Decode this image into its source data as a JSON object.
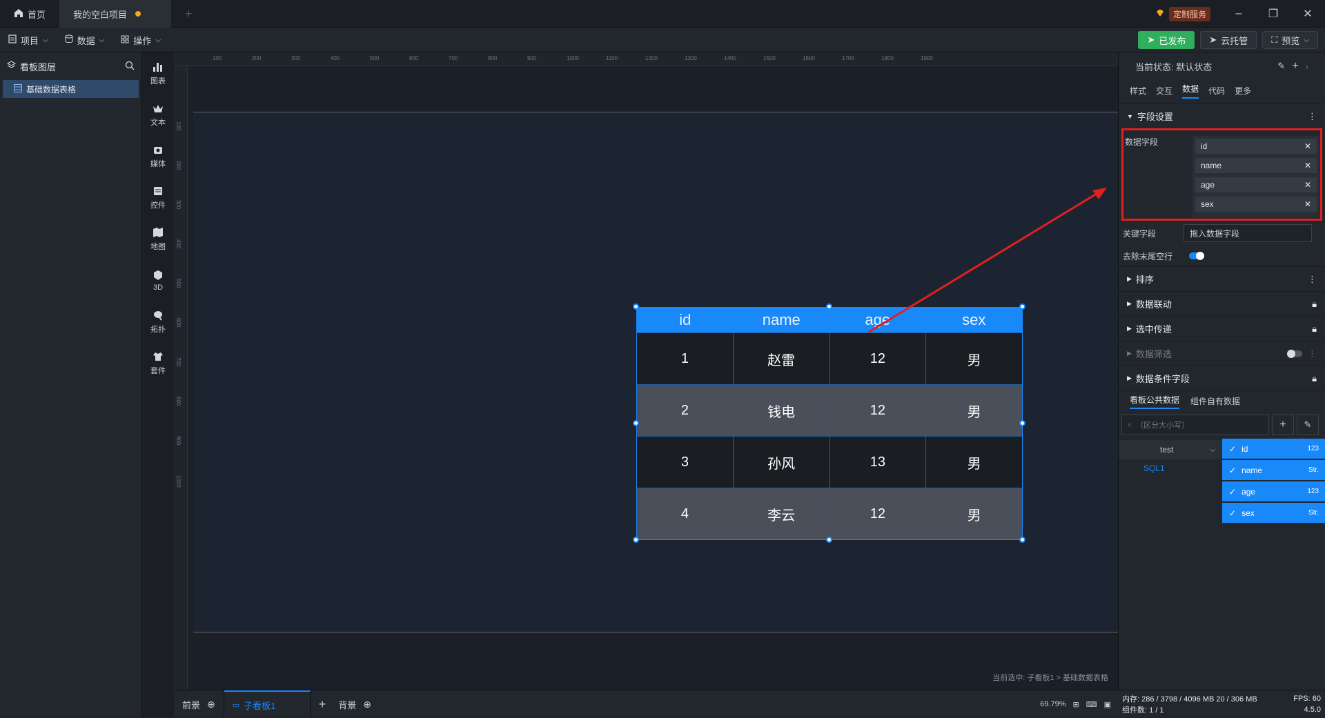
{
  "titlebar": {
    "home_tab": "首页",
    "project_tab": "我的空白项目",
    "service_badge": "定制服务"
  },
  "toolbar": {
    "menu_project": "项目",
    "menu_data": "数据",
    "menu_ops": "操作",
    "publish": "已发布",
    "cloud": "云托管",
    "preview": "预览"
  },
  "layers": {
    "title": "看板图层",
    "items": [
      "基础数据表格"
    ]
  },
  "iconbar": {
    "items": [
      {
        "label": "图表",
        "icon": "bar-chart-icon"
      },
      {
        "label": "文本",
        "icon": "text-icon"
      },
      {
        "label": "媒体",
        "icon": "media-icon"
      },
      {
        "label": "控件",
        "icon": "widget-icon"
      },
      {
        "label": "地图",
        "icon": "map-icon"
      },
      {
        "label": "3D",
        "icon": "cube-icon"
      },
      {
        "label": "拓扑",
        "icon": "topology-icon"
      },
      {
        "label": "套件",
        "icon": "kit-icon"
      }
    ]
  },
  "ruler": {
    "top": [
      "100",
      "200",
      "300",
      "400",
      "500",
      "600",
      "700",
      "800",
      "900",
      "1000",
      "1100",
      "1200",
      "1300",
      "1400",
      "1500",
      "1600",
      "1700",
      "1800",
      "1900"
    ],
    "left": [
      "100",
      "200",
      "300",
      "400",
      "500",
      "600",
      "700",
      "800",
      "900",
      "1000"
    ]
  },
  "table": {
    "headers": [
      "id",
      "name",
      "age",
      "sex"
    ],
    "rows": [
      [
        "1",
        "赵雷",
        "12",
        "男"
      ],
      [
        "2",
        "钱电",
        "12",
        "男"
      ],
      [
        "3",
        "孙风",
        "13",
        "男"
      ],
      [
        "4",
        "李云",
        "12",
        "男"
      ]
    ]
  },
  "canvas": {
    "selection_info": "当前选中: 子看板1 > 基础数据表格"
  },
  "bottombar": {
    "front": "前景",
    "sub_board": "子看板1",
    "background": "背景",
    "zoom": "69.79%"
  },
  "rightpanel": {
    "state_label": "当前状态: 默认状态",
    "tabs": [
      "样式",
      "交互",
      "数据",
      "代码",
      "更多"
    ],
    "active_tab": "数据",
    "field_settings": "字段设置",
    "data_fields_label": "数据字段",
    "data_fields": [
      "id",
      "name",
      "age",
      "sex"
    ],
    "key_field_label": "关键字段",
    "key_field_placeholder": "拖入数据字段",
    "trim_label": "去除末尾空行",
    "sections": [
      "排序",
      "数据联动",
      "选中传递",
      "数据筛选",
      "数据条件字段"
    ],
    "source_tabs": [
      "看板公共数据",
      "组件自有数据"
    ],
    "search_placeholder": "（区分大小写）",
    "dataset": "test",
    "source": "SQL1",
    "columns": [
      {
        "name": "id",
        "type": "123"
      },
      {
        "name": "name",
        "type": "Str."
      },
      {
        "name": "age",
        "type": "123"
      },
      {
        "name": "sex",
        "type": "Str."
      }
    ]
  },
  "status": {
    "memory": "内存: 286 / 3798 / 4096 MB  20 / 306 MB",
    "fps": "FPS: 60",
    "components": "组件数: 1 / 1",
    "version": "4.5.0"
  },
  "colors": {
    "accent": "#1989fa",
    "highlight_box": "#e02020",
    "publish": "#2fae5c"
  }
}
